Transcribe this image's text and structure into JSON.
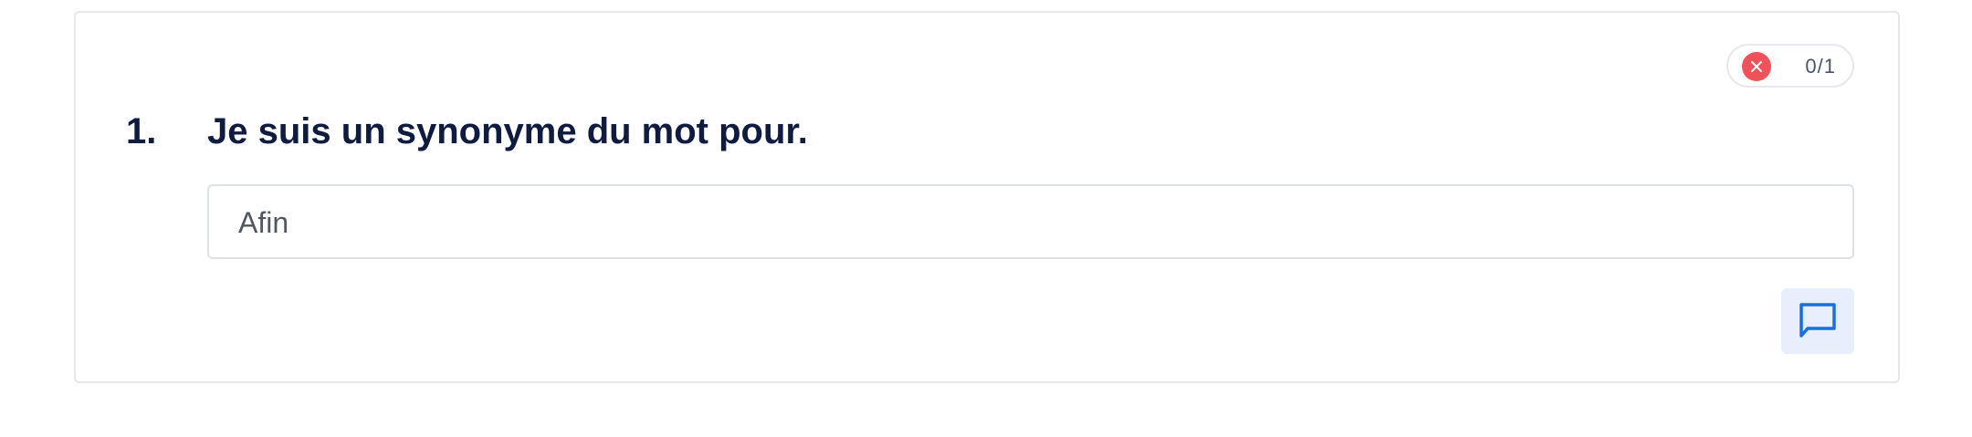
{
  "question": {
    "number": "1.",
    "text": "Je suis un synonyme du mot pour.",
    "answer_value": "Afin",
    "score": "0/1",
    "status": "incorrect",
    "status_icon": "x-circle-icon",
    "comment_icon": "comment-icon"
  },
  "colors": {
    "incorrect": "#f0525a",
    "text_primary": "#0f1c3f",
    "accent": "#1a6fdc",
    "accent_light": "#e6effb"
  }
}
